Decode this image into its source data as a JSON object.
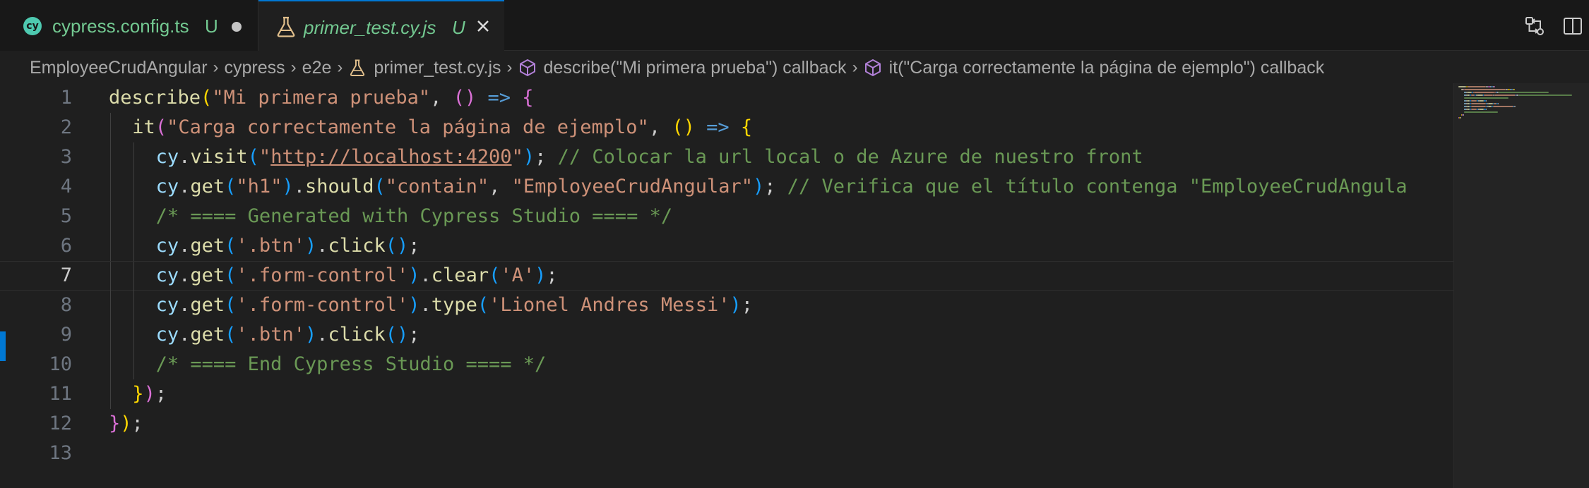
{
  "tabs": [
    {
      "icon": "cy",
      "name": "cypress.config.ts",
      "status": "U"
    },
    {
      "name": "primer_test.cy.js",
      "status": "U"
    }
  ],
  "breadcrumb": [
    "EmployeeCrudAngular",
    "cypress",
    "e2e",
    "primer_test.cy.js",
    "describe(\"Mi primera prueba\") callback",
    "it(\"Carga correctamente la página de ejemplo\") callback"
  ],
  "editor": {
    "line_numbers": [
      "1",
      "2",
      "3",
      "4",
      "5",
      "6",
      "7",
      "8",
      "9",
      "10",
      "11",
      "12",
      "13"
    ],
    "active_line": "7",
    "lines": [
      [
        {
          "t": "describe",
          "c": "fn"
        },
        {
          "t": "(",
          "c": "p1"
        },
        {
          "t": "\"Mi primera prueba\"",
          "c": "str"
        },
        {
          "t": ", ",
          "c": "pl"
        },
        {
          "t": "()",
          "c": "p2"
        },
        {
          "t": " ",
          "c": "pl"
        },
        {
          "t": "=>",
          "c": "kw"
        },
        {
          "t": " ",
          "c": "pl"
        },
        {
          "t": "{",
          "c": "p2"
        }
      ],
      [
        {
          "t": "it",
          "c": "fn"
        },
        {
          "t": "(",
          "c": "p2"
        },
        {
          "t": "\"Carga correctamente la página de ejemplo\"",
          "c": "str"
        },
        {
          "t": ", ",
          "c": "pl"
        },
        {
          "t": "()",
          "c": "p1"
        },
        {
          "t": " ",
          "c": "pl"
        },
        {
          "t": "=>",
          "c": "kw"
        },
        {
          "t": " ",
          "c": "pl"
        },
        {
          "t": "{",
          "c": "p1"
        }
      ],
      [
        {
          "t": "cy",
          "c": "var"
        },
        {
          "t": ".",
          "c": "pl"
        },
        {
          "t": "visit",
          "c": "fn"
        },
        {
          "t": "(",
          "c": "p3"
        },
        {
          "t": "\"",
          "c": "str"
        },
        {
          "t": "http://localhost:4200",
          "c": "str url"
        },
        {
          "t": "\"",
          "c": "str"
        },
        {
          "t": ")",
          "c": "p3"
        },
        {
          "t": "; ",
          "c": "pl"
        },
        {
          "t": "// Colocar la url local o de Azure de nuestro front",
          "c": "com"
        }
      ],
      [
        {
          "t": "cy",
          "c": "var"
        },
        {
          "t": ".",
          "c": "pl"
        },
        {
          "t": "get",
          "c": "fn"
        },
        {
          "t": "(",
          "c": "p3"
        },
        {
          "t": "\"h1\"",
          "c": "str"
        },
        {
          "t": ")",
          "c": "p3"
        },
        {
          "t": ".",
          "c": "pl"
        },
        {
          "t": "should",
          "c": "fn"
        },
        {
          "t": "(",
          "c": "p3"
        },
        {
          "t": "\"contain\"",
          "c": "str"
        },
        {
          "t": ", ",
          "c": "pl"
        },
        {
          "t": "\"EmployeeCrudAngular\"",
          "c": "str"
        },
        {
          "t": ")",
          "c": "p3"
        },
        {
          "t": "; ",
          "c": "pl"
        },
        {
          "t": "// Verifica que el título contenga \"EmployeeCrudAngula",
          "c": "com"
        }
      ],
      [
        {
          "t": "/* ==== Generated with Cypress Studio ==== */",
          "c": "com"
        }
      ],
      [
        {
          "t": "cy",
          "c": "var"
        },
        {
          "t": ".",
          "c": "pl"
        },
        {
          "t": "get",
          "c": "fn"
        },
        {
          "t": "(",
          "c": "p3"
        },
        {
          "t": "'.btn'",
          "c": "str"
        },
        {
          "t": ")",
          "c": "p3"
        },
        {
          "t": ".",
          "c": "pl"
        },
        {
          "t": "click",
          "c": "fn"
        },
        {
          "t": "()",
          "c": "p3"
        },
        {
          "t": ";",
          "c": "pl"
        }
      ],
      [
        {
          "t": "cy",
          "c": "var"
        },
        {
          "t": ".",
          "c": "pl"
        },
        {
          "t": "get",
          "c": "fn"
        },
        {
          "t": "(",
          "c": "p3"
        },
        {
          "t": "'.form-control'",
          "c": "str"
        },
        {
          "t": ")",
          "c": "p3"
        },
        {
          "t": ".",
          "c": "pl"
        },
        {
          "t": "clear",
          "c": "fn"
        },
        {
          "t": "(",
          "c": "p3"
        },
        {
          "t": "'A'",
          "c": "str"
        },
        {
          "t": ")",
          "c": "p3"
        },
        {
          "t": ";",
          "c": "pl"
        }
      ],
      [
        {
          "t": "cy",
          "c": "var"
        },
        {
          "t": ".",
          "c": "pl"
        },
        {
          "t": "get",
          "c": "fn"
        },
        {
          "t": "(",
          "c": "p3"
        },
        {
          "t": "'.form-control'",
          "c": "str"
        },
        {
          "t": ")",
          "c": "p3"
        },
        {
          "t": ".",
          "c": "pl"
        },
        {
          "t": "type",
          "c": "fn"
        },
        {
          "t": "(",
          "c": "p3"
        },
        {
          "t": "'Lionel Andres Messi'",
          "c": "str"
        },
        {
          "t": ")",
          "c": "p3"
        },
        {
          "t": ";",
          "c": "pl"
        }
      ],
      [
        {
          "t": "cy",
          "c": "var"
        },
        {
          "t": ".",
          "c": "pl"
        },
        {
          "t": "get",
          "c": "fn"
        },
        {
          "t": "(",
          "c": "p3"
        },
        {
          "t": "'.btn'",
          "c": "str"
        },
        {
          "t": ")",
          "c": "p3"
        },
        {
          "t": ".",
          "c": "pl"
        },
        {
          "t": "click",
          "c": "fn"
        },
        {
          "t": "()",
          "c": "p3"
        },
        {
          "t": ";",
          "c": "pl"
        }
      ],
      [
        {
          "t": "/* ==== End Cypress Studio ==== */",
          "c": "com"
        }
      ],
      [
        {
          "t": "}",
          "c": "p1"
        },
        {
          "t": ")",
          "c": "p2"
        },
        {
          "t": ";",
          "c": "pl"
        }
      ],
      [
        {
          "t": "}",
          "c": "p2"
        },
        {
          "t": ")",
          "c": "p1"
        },
        {
          "t": ";",
          "c": "pl"
        }
      ],
      []
    ]
  }
}
